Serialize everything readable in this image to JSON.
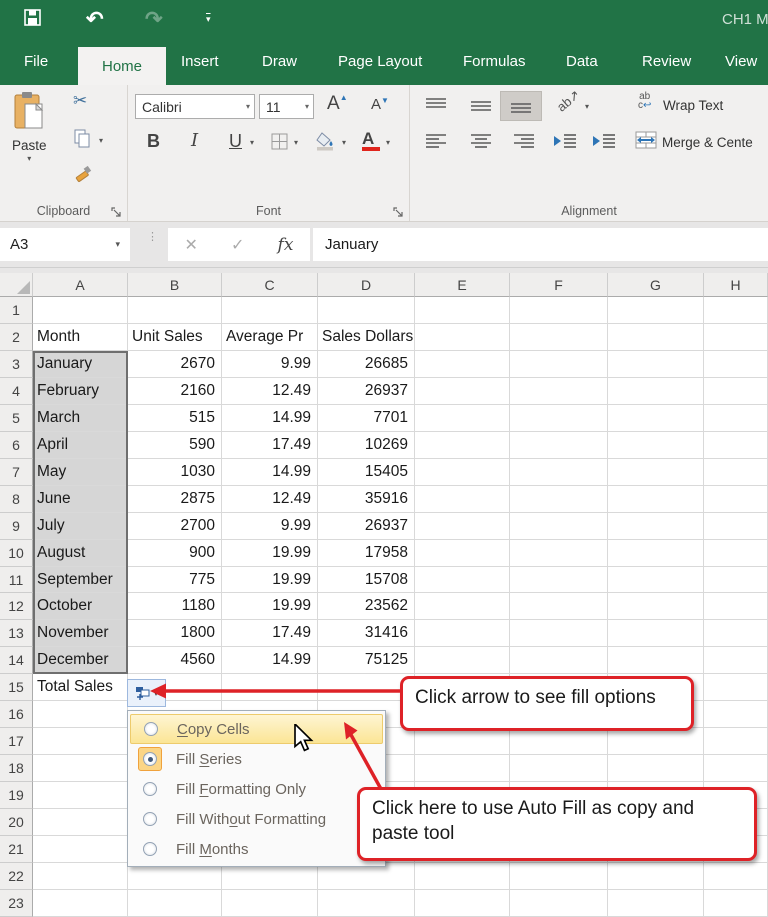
{
  "titlebar": {
    "title": "CH1 M"
  },
  "tabs": {
    "active_index": 1,
    "items": [
      "File",
      "Home",
      "Insert",
      "Draw",
      "Page Layout",
      "Formulas",
      "Data",
      "Review",
      "View"
    ]
  },
  "ribbon": {
    "clipboard": {
      "label": "Clipboard",
      "paste_label": "Paste"
    },
    "font": {
      "label": "Font",
      "family": "Calibri",
      "size": "11",
      "bold": "B",
      "italic": "I",
      "underline": "U"
    },
    "alignment": {
      "label": "Alignment",
      "wrap_text_label": "Wrap Text",
      "merge_center_label": "Merge & Cente"
    }
  },
  "formula_bar": {
    "name_box_value": "A3",
    "fx_label": "fx",
    "formula_value": "January"
  },
  "sheet": {
    "column_headers": [
      "A",
      "B",
      "C",
      "D",
      "E",
      "F",
      "G",
      "H"
    ],
    "selection": {
      "col": "A",
      "row_from": 3,
      "row_to": 14,
      "active_cell": "A3"
    },
    "rows": [
      {
        "n": 1
      },
      {
        "n": 2,
        "A": "Month",
        "B": "Unit Sales",
        "C": "Average Pr",
        "D": "Sales Dollars"
      },
      {
        "n": 3,
        "A": "January",
        "B": "2670",
        "C": "9.99",
        "D": "26685"
      },
      {
        "n": 4,
        "A": "February",
        "B": "2160",
        "C": "12.49",
        "D": "26937"
      },
      {
        "n": 5,
        "A": "March",
        "B": "515",
        "C": "14.99",
        "D": "7701"
      },
      {
        "n": 6,
        "A": "April",
        "B": "590",
        "C": "17.49",
        "D": "10269"
      },
      {
        "n": 7,
        "A": "May",
        "B": "1030",
        "C": "14.99",
        "D": "15405"
      },
      {
        "n": 8,
        "A": "June",
        "B": "2875",
        "C": "12.49",
        "D": "35916"
      },
      {
        "n": 9,
        "A": "July",
        "B": "2700",
        "C": "9.99",
        "D": "26937"
      },
      {
        "n": 10,
        "A": "August",
        "B": "900",
        "C": "19.99",
        "D": "17958"
      },
      {
        "n": 11,
        "A": "September",
        "B": "775",
        "C": "19.99",
        "D": "15708"
      },
      {
        "n": 12,
        "A": "October",
        "B": "1180",
        "C": "19.99",
        "D": "23562"
      },
      {
        "n": 13,
        "A": "November",
        "B": "1800",
        "C": "17.49",
        "D": "31416"
      },
      {
        "n": 14,
        "A": "December",
        "B": "4560",
        "C": "14.99",
        "D": "75125"
      },
      {
        "n": 15,
        "A": "Total Sales"
      },
      {
        "n": 16
      },
      {
        "n": 17
      },
      {
        "n": 18
      },
      {
        "n": 19
      },
      {
        "n": 20
      },
      {
        "n": 21
      },
      {
        "n": 22
      },
      {
        "n": 23
      }
    ]
  },
  "autofill": {
    "menu_items": [
      {
        "label": "Copy Cells",
        "underline_index": 0,
        "state": "hovered"
      },
      {
        "label": "Fill Series",
        "underline_index": 5,
        "state": "selected"
      },
      {
        "label": "Fill Formatting Only",
        "underline_index": 5,
        "state": "normal"
      },
      {
        "label": "Fill Without Formatting",
        "underline_index": 9,
        "state": "normal"
      },
      {
        "label": "Fill Months",
        "underline_index": 5,
        "state": "normal"
      }
    ]
  },
  "callouts": {
    "fill_options": "Click arrow to see fill options",
    "autofill_copy": "Click here to use Auto Fill as copy and paste tool"
  },
  "colors": {
    "excel_green": "#217346",
    "callout_red": "#DE2227",
    "menu_highlight": "#FBE595",
    "selection_gray": "#D6D6D6"
  }
}
